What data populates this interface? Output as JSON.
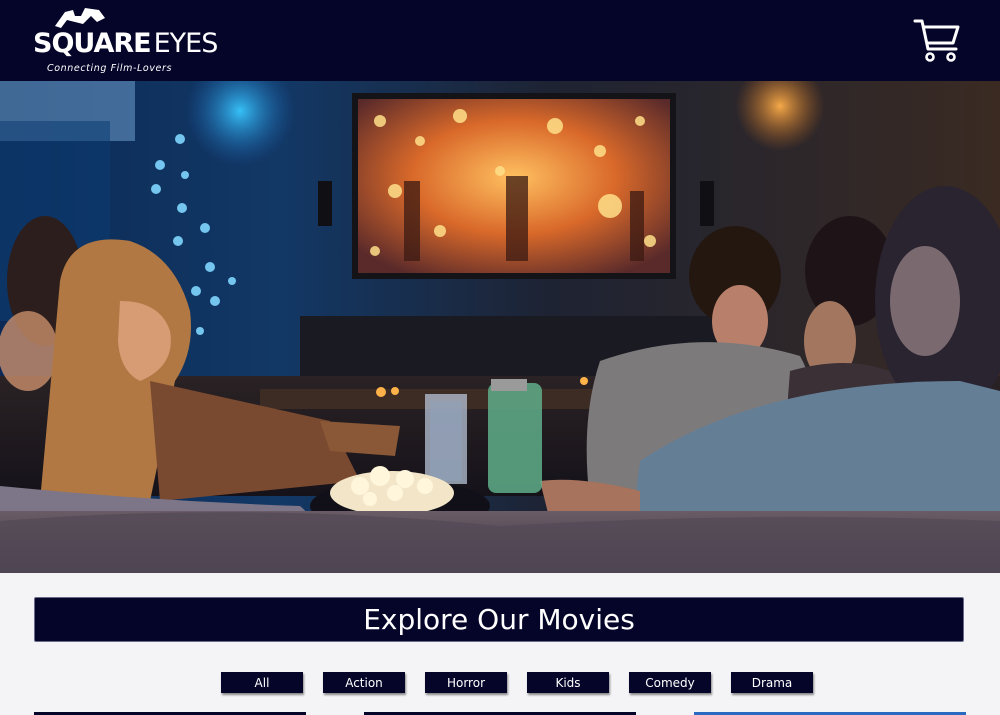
{
  "header": {
    "logo": {
      "name_bold": "SQUARE",
      "name_thin": "EYES",
      "tagline": "Connecting Film-Lovers"
    },
    "cart_icon": "shopping-cart-icon"
  },
  "hero": {
    "image": "friends-watching-movie-on-tv-photo"
  },
  "explore": {
    "title": "Explore Our Movies",
    "filters": [
      "All",
      "Action",
      "Horror",
      "Kids",
      "Comedy",
      "Drama"
    ]
  },
  "colors": {
    "navy": "#05052a",
    "page_bg": "#f4f4f6",
    "text_light": "#ffffff"
  }
}
